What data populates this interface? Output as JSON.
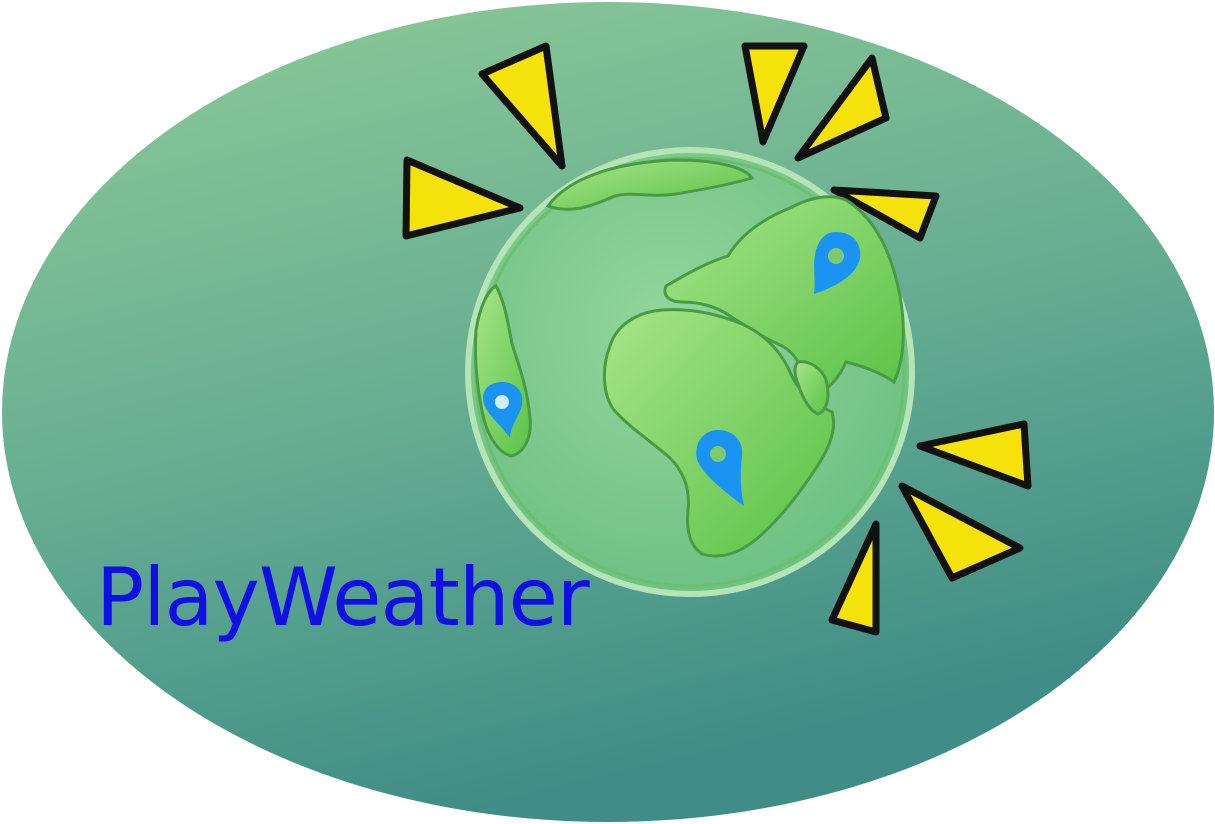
{
  "app": {
    "name": "PlayWeather"
  },
  "colors": {
    "background_top": "#8fcb98",
    "background_bottom": "#3f8d86",
    "wordmark": "#1010e6",
    "globe_ocean": "#7cc98a",
    "globe_land": "#6ecf56",
    "globe_land_light": "#a6e489",
    "sun_ray_fill": "#f5e20a",
    "sun_ray_stroke": "#111111",
    "pin": "#1b93f2"
  },
  "icons": {
    "globe": "globe-icon",
    "sun_rays": "sun-ray-icon",
    "pins": "map-pin-icon"
  }
}
